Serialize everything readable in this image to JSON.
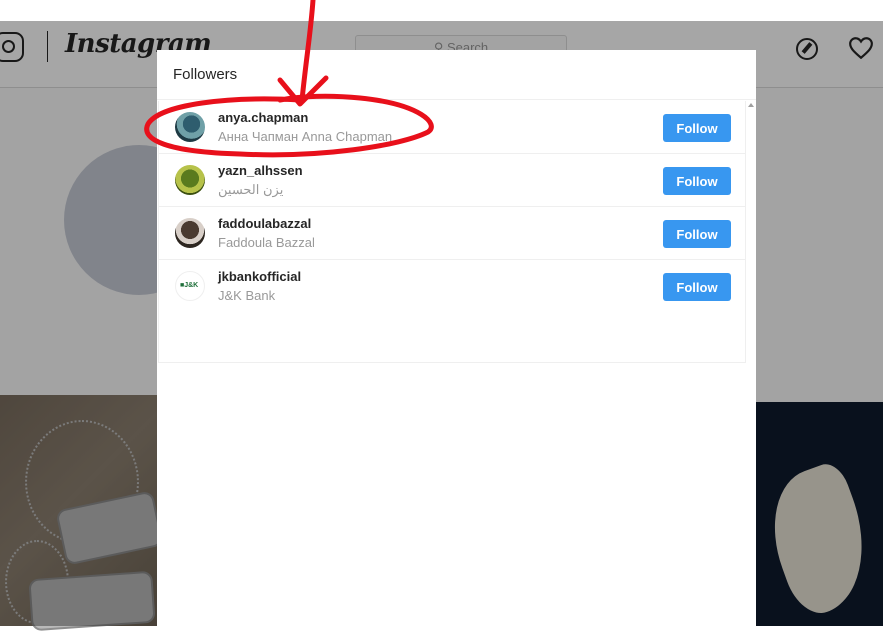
{
  "background": {
    "brand_wordmark": "Instagram",
    "search_placeholder": "Search",
    "icons": [
      "instagram-glyph-icon",
      "compass-icon",
      "heart-icon"
    ]
  },
  "modal": {
    "title": "Followers",
    "followers": [
      {
        "username": "anya.chapman",
        "full_name": "Анна Чапман Anna Chapman",
        "button": "Follow"
      },
      {
        "username": "yazn_alhssen",
        "full_name": "يزن الحسين",
        "button": "Follow"
      },
      {
        "username": "faddoulabazzal",
        "full_name": "Faddoula Bazzal",
        "button": "Follow"
      },
      {
        "username": "jkbankofficial",
        "full_name": "J&K Bank",
        "button": "Follow"
      }
    ]
  },
  "colors": {
    "follow_button": "#3897f0",
    "annotation": "#e8101b",
    "secondary_text": "#999999"
  }
}
